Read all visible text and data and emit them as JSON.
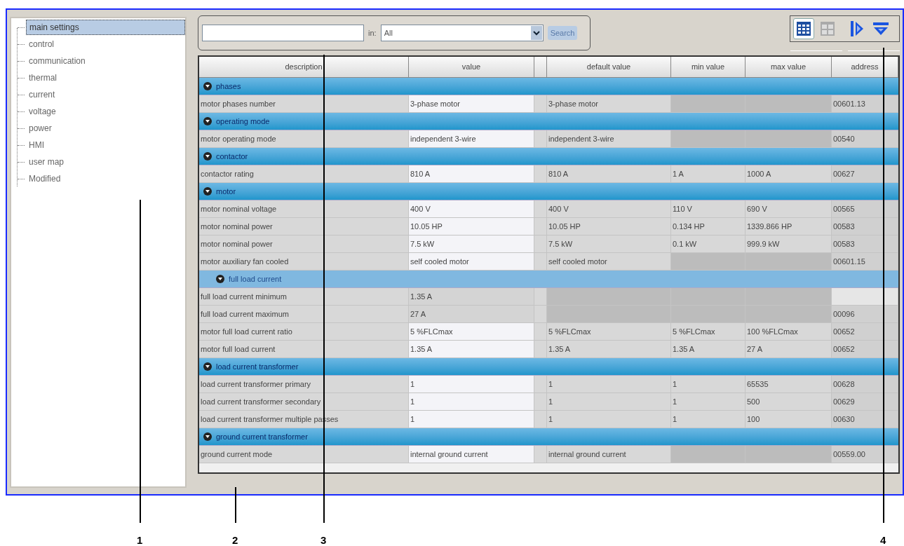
{
  "tree": {
    "items": [
      {
        "label": "main settings",
        "selected": true
      },
      {
        "label": "control",
        "selected": false
      },
      {
        "label": "communication",
        "selected": false
      },
      {
        "label": "thermal",
        "selected": false
      },
      {
        "label": "current",
        "selected": false
      },
      {
        "label": "voltage",
        "selected": false
      },
      {
        "label": "power",
        "selected": false
      },
      {
        "label": "HMI",
        "selected": false
      },
      {
        "label": "user map",
        "selected": false
      },
      {
        "label": "Modified",
        "selected": false
      }
    ]
  },
  "search": {
    "in_label": "in:",
    "scope": "All",
    "button": "Search"
  },
  "view_buttons": [
    {
      "kind": "table",
      "selected": true
    },
    {
      "kind": "tiles",
      "selected": false
    },
    {
      "kind": "expand",
      "selected": false
    },
    {
      "kind": "collapse",
      "selected": false
    }
  ],
  "table": {
    "columns": [
      "description",
      "value",
      "",
      "default value",
      "min value",
      "max value",
      "address"
    ],
    "rows": [
      {
        "kind": "group",
        "title": "phases",
        "expanded": true
      },
      {
        "kind": "param",
        "editable": true,
        "cells": [
          "motor phases number",
          "3-phase motor",
          "3-phase motor",
          "",
          "",
          "00601.13"
        ]
      },
      {
        "kind": "group",
        "title": "operating mode",
        "expanded": true
      },
      {
        "kind": "param",
        "editable": true,
        "cells": [
          "motor operating mode",
          "independent 3-wire",
          "independent 3-wire",
          "",
          "",
          "00540"
        ]
      },
      {
        "kind": "group",
        "title": "contactor",
        "expanded": true
      },
      {
        "kind": "param",
        "editable": true,
        "cells": [
          "contactor rating",
          "810 A",
          "810 A",
          "1 A",
          "1000 A",
          "00627"
        ]
      },
      {
        "kind": "group",
        "title": "motor",
        "expanded": true
      },
      {
        "kind": "param",
        "editable": true,
        "cells": [
          "motor nominal voltage",
          "400 V",
          "400 V",
          "110 V",
          "690 V",
          "00565"
        ]
      },
      {
        "kind": "param",
        "editable": true,
        "cells": [
          "motor nominal power",
          "10.05 HP",
          "10.05 HP",
          "0.134 HP",
          "1339.866 HP",
          "00583"
        ]
      },
      {
        "kind": "param",
        "editable": true,
        "cells": [
          "motor nominal power",
          "7.5 kW",
          "7.5 kW",
          "0.1 kW",
          "999.9 kW",
          "00583"
        ]
      },
      {
        "kind": "param",
        "editable": true,
        "cells": [
          "motor auxiliary fan cooled",
          "self cooled motor",
          "self cooled motor",
          "",
          "",
          "00601.15"
        ]
      },
      {
        "kind": "subgroup",
        "title": "full load current",
        "expanded": true
      },
      {
        "kind": "param",
        "editable": false,
        "cells": [
          "full load current minimum",
          "1.35 A",
          "",
          "",
          "",
          ""
        ]
      },
      {
        "kind": "param",
        "editable": false,
        "cells": [
          "full load current maximum",
          "27 A",
          "",
          "",
          "",
          "00096"
        ]
      },
      {
        "kind": "param",
        "editable": true,
        "cells": [
          "motor full load current ratio",
          "5 %FLCmax",
          "5 %FLCmax",
          "5 %FLCmax",
          "100 %FLCmax",
          "00652"
        ]
      },
      {
        "kind": "param",
        "editable": true,
        "cells": [
          "motor full load current",
          "1.35 A",
          "1.35 A",
          "1.35 A",
          "27 A",
          "00652"
        ]
      },
      {
        "kind": "group",
        "title": "load current transformer",
        "expanded": true
      },
      {
        "kind": "param",
        "editable": true,
        "cells": [
          "load current transformer primary",
          "1",
          "1",
          "1",
          "65535",
          "00628"
        ]
      },
      {
        "kind": "param",
        "editable": true,
        "cells": [
          "load current transformer secondary",
          "1",
          "1",
          "1",
          "500",
          "00629"
        ]
      },
      {
        "kind": "param",
        "editable": true,
        "cells": [
          "load current transformer multiple passes",
          "1",
          "1",
          "1",
          "100",
          "00630"
        ]
      },
      {
        "kind": "group",
        "title": "ground current transformer",
        "expanded": true
      },
      {
        "kind": "param",
        "editable": true,
        "cells": [
          "ground current mode",
          "internal ground current",
          "internal ground current",
          "",
          "",
          "00559.00"
        ]
      }
    ]
  },
  "callouts": [
    {
      "number": "1"
    },
    {
      "number": "2"
    },
    {
      "number": "3"
    },
    {
      "number": "4"
    }
  ]
}
